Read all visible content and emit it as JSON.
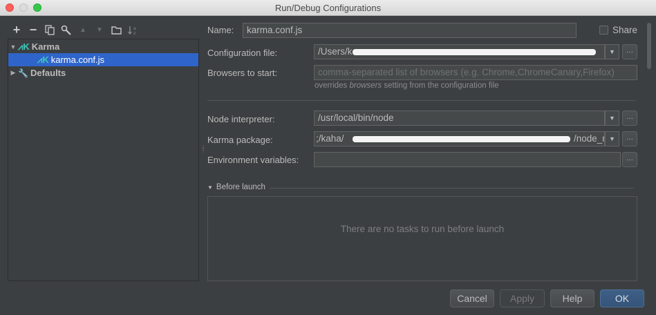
{
  "window": {
    "title": "Run/Debug Configurations"
  },
  "toolbar": {
    "buttons": [
      {
        "name": "add-icon",
        "glyph": "+"
      },
      {
        "name": "remove-icon",
        "glyph": "−"
      },
      {
        "name": "copy-icon",
        "glyph": ""
      },
      {
        "name": "wrench-icon",
        "glyph": ""
      },
      {
        "name": "move-up-icon",
        "glyph": "▲"
      },
      {
        "name": "move-down-icon",
        "glyph": "▼"
      },
      {
        "name": "folder-icon",
        "glyph": ""
      },
      {
        "name": "sort-icon",
        "glyph": ""
      }
    ]
  },
  "tree": {
    "karma_label": "Karma",
    "config_label": "karma.conf.js",
    "defaults_label": "Defaults"
  },
  "form": {
    "name_label": "Name:",
    "name_value": "karma.conf.js",
    "share_label": "Share",
    "config_file_label": "Configuration file:",
    "config_file_value": "/Users/k",
    "browsers_label": "Browsers to start:",
    "browsers_placeholder": "comma-separated list of browsers (e.g. Chrome,ChromeCanary,Firefox)",
    "browsers_hint_prefix": "overrides ",
    "browsers_hint_em": "browsers",
    "browsers_hint_suffix": " setting from the configuration file",
    "node_label": "Node interpreter:",
    "node_value": "/usr/local/bin/node",
    "karma_pkg_label": "Karma package:",
    "karma_pkg_prefix": ";/kaha/",
    "karma_pkg_suffix": "/node_r",
    "env_label": "Environment variables:",
    "env_value": ""
  },
  "before_launch": {
    "header": "Before launch",
    "empty_text": "There are no tasks to run before launch"
  },
  "buttons": {
    "cancel": "Cancel",
    "apply": "Apply",
    "help": "Help",
    "ok": "OK"
  },
  "colors": {
    "background": "#3c3f41",
    "selection": "#2f65ca",
    "karma_icon": "#3ec7b8",
    "default_button": "#3e5f86"
  }
}
